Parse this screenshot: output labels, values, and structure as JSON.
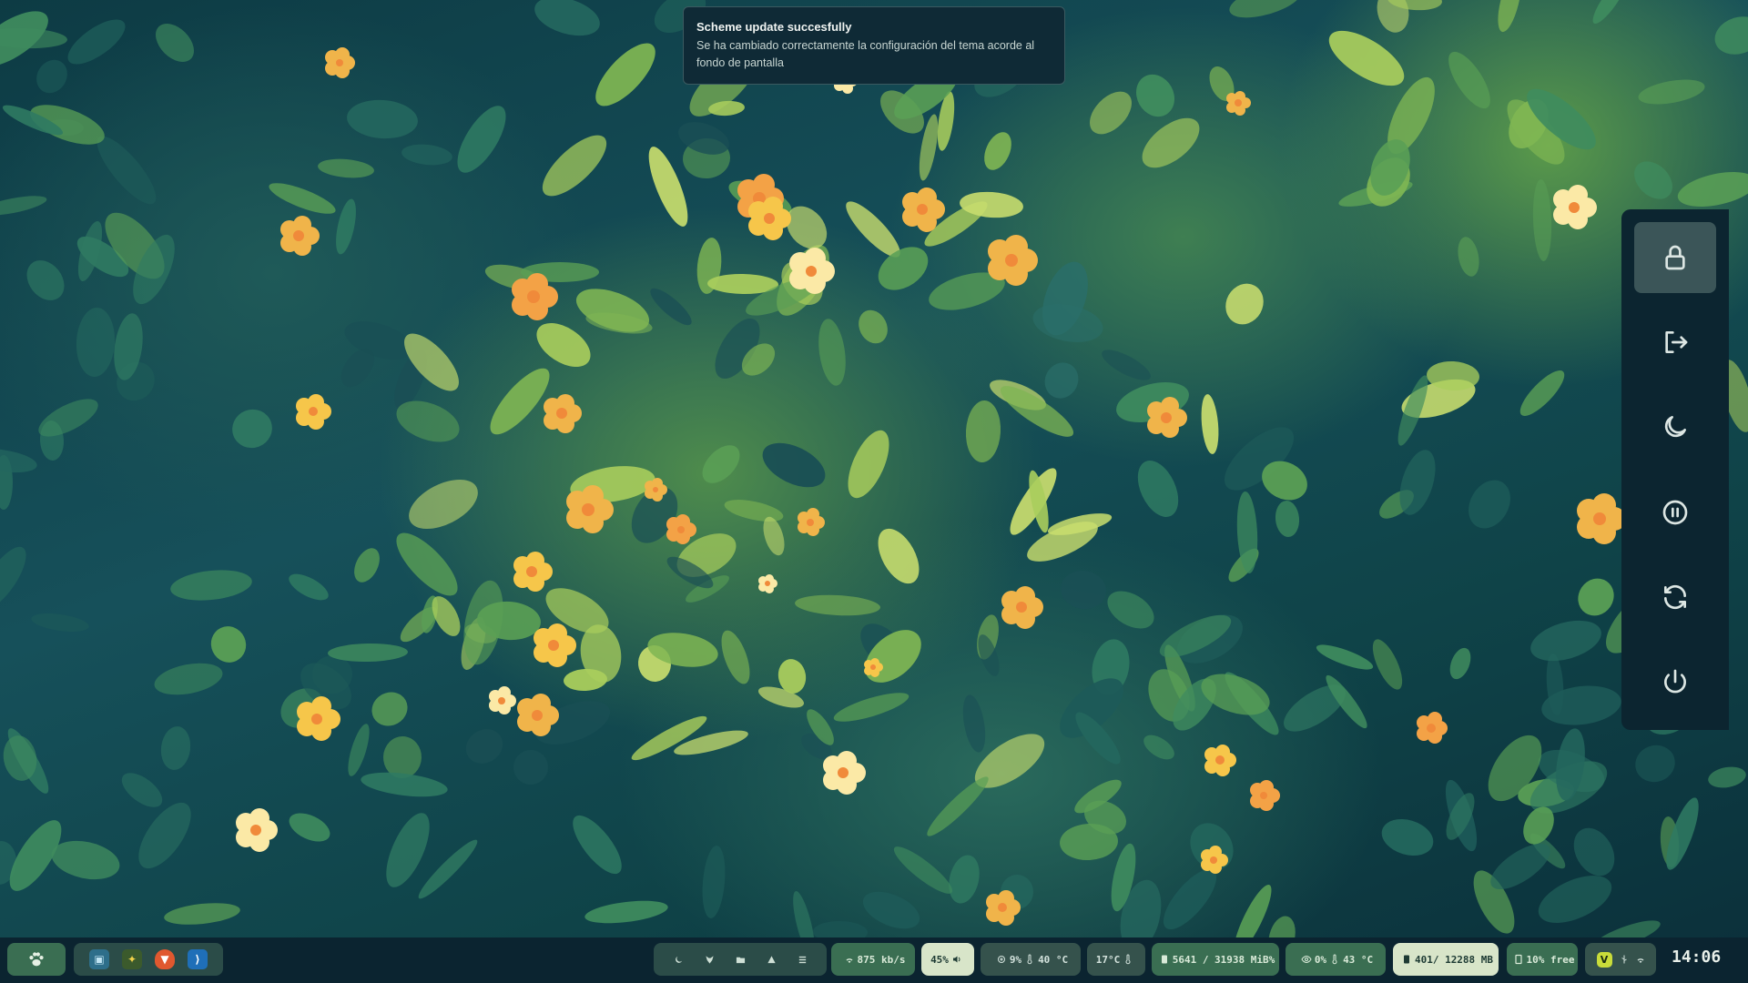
{
  "notification": {
    "title": "Scheme update succesfully",
    "body": "Se ha cambiado correctamente la configuración del tema acorde al fondo de pantalla"
  },
  "power_menu": {
    "items": [
      {
        "icon": "lock-icon",
        "active": true
      },
      {
        "icon": "logout-icon",
        "active": false
      },
      {
        "icon": "moon-icon",
        "active": false
      },
      {
        "icon": "pause-icon",
        "active": false
      },
      {
        "icon": "refresh-icon",
        "active": false
      },
      {
        "icon": "power-icon",
        "active": false
      }
    ]
  },
  "taskbar": {
    "launcher_icon": "paw-icon",
    "apps": [
      {
        "icon": "window-icon"
      },
      {
        "icon": "python-icon"
      },
      {
        "icon": "brave-icon"
      },
      {
        "icon": "vscode-icon"
      }
    ],
    "workspaces": [
      "moon-icon",
      "fox-icon",
      "folder-icon",
      "bell-icon",
      "list-icon"
    ],
    "network": "875 kb/s",
    "volume": "45%",
    "cpu": "9%",
    "cpu_temp": "40 °C",
    "weather_temp": "17°C",
    "memory": "5641 / 31938 MiB%",
    "gpu": "0%",
    "gpu_temp": "43 °C",
    "vram": "401/ 12288 MB",
    "disk": "10% free",
    "clock": "14:06"
  }
}
